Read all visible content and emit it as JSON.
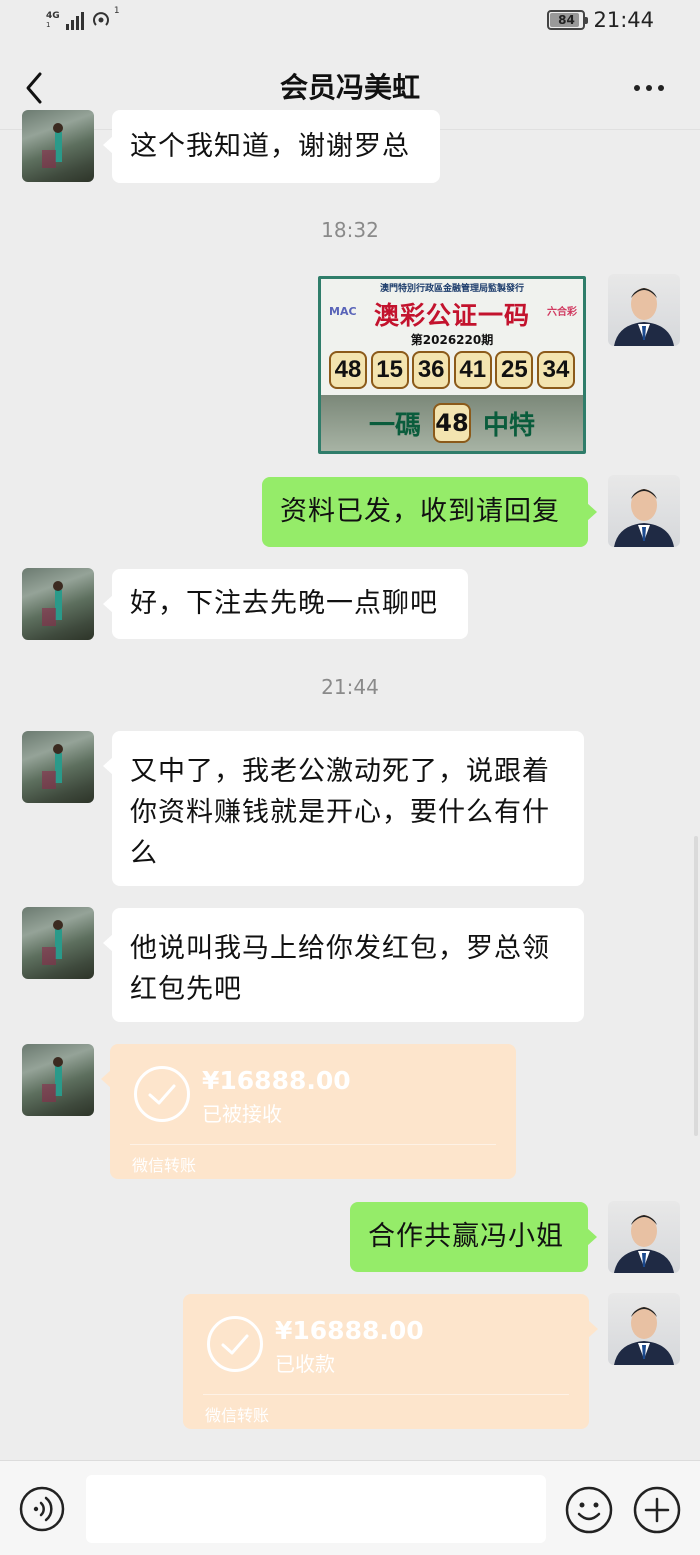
{
  "status_bar": {
    "network": "4G",
    "network_sub": "1",
    "hotspot_sup": "1",
    "battery": "84",
    "time": "21:44"
  },
  "header": {
    "title": "会员冯美虹"
  },
  "messages": {
    "m1": "这个我知道，谢谢罗总",
    "time1": "18:32",
    "lottery": {
      "header": "澳門特別行政區金融管理局監製發行",
      "logo_left": "MAC",
      "title": "澳彩公证一码",
      "logo_right": "六合彩",
      "period": "第2026220期",
      "numbers": [
        "48",
        "15",
        "36",
        "41",
        "25",
        "34"
      ],
      "bottom_left": "一碼",
      "special": "48",
      "bottom_right": "中特"
    },
    "m2": "资料已发，收到请回复",
    "m3": "好，下注去先晚一点聊吧",
    "time2": "21:44",
    "m4": "又中了，我老公激动死了，说跟着你资料赚钱就是开心，要什么有什么",
    "m5": "他说叫我马上给你发红包，罗总领红包先吧",
    "transfer1": {
      "amount": "¥16888.00",
      "status": "已被接收",
      "label": "微信转账"
    },
    "m6": "合作共赢冯小姐",
    "transfer2": {
      "amount": "¥16888.00",
      "status": "已收款",
      "label": "微信转账"
    }
  },
  "input_bar": {
    "value": "",
    "placeholder": ""
  },
  "colors": {
    "bg": "#ededed",
    "bubble_out": "#95ec69",
    "bubble_in": "#ffffff",
    "transfer": "#fde5cc"
  },
  "icons": [
    "back-arrow-icon",
    "more-icon",
    "voice-icon",
    "emoji-icon",
    "plus-icon",
    "check-circle-icon",
    "signal-icon",
    "hotspot-icon",
    "battery-icon"
  ]
}
